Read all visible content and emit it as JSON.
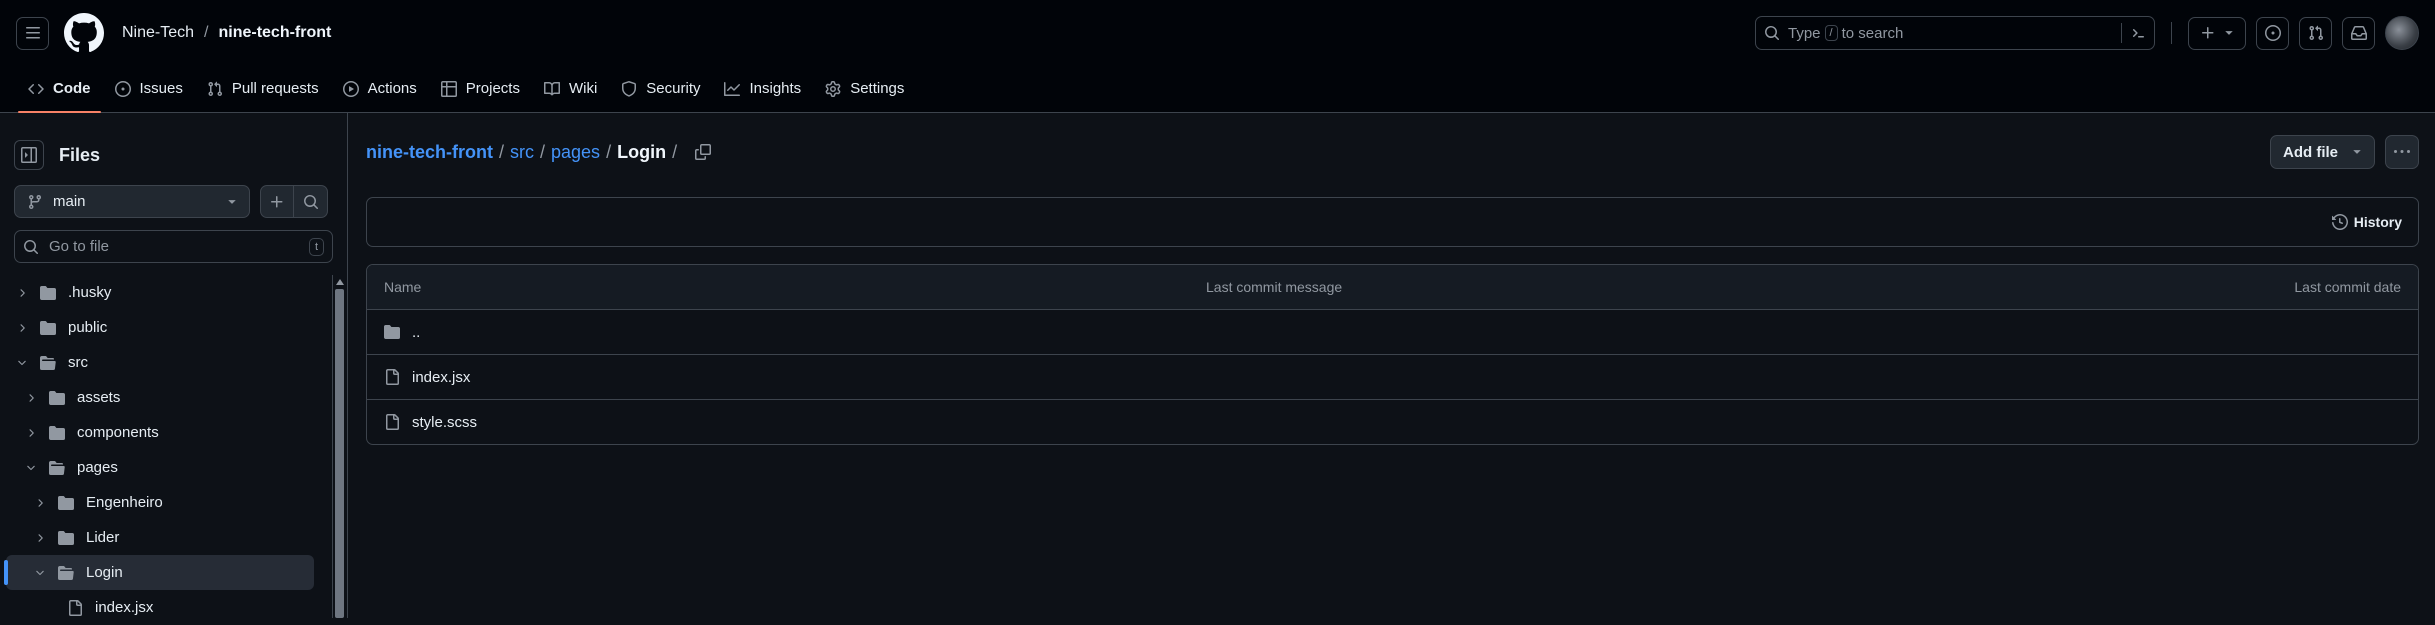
{
  "header": {
    "owner": "Nine-Tech",
    "separator": "/",
    "repo": "nine-tech-front",
    "search": {
      "prefix": "Type",
      "key": "/",
      "suffix": "to search"
    }
  },
  "tabs": [
    {
      "label": "Code",
      "icon": "code-icon",
      "active": true
    },
    {
      "label": "Issues",
      "icon": "issue-icon"
    },
    {
      "label": "Pull requests",
      "icon": "pull-request-icon"
    },
    {
      "label": "Actions",
      "icon": "play-icon"
    },
    {
      "label": "Projects",
      "icon": "table-icon"
    },
    {
      "label": "Wiki",
      "icon": "book-icon"
    },
    {
      "label": "Security",
      "icon": "shield-icon"
    },
    {
      "label": "Insights",
      "icon": "graph-icon"
    },
    {
      "label": "Settings",
      "icon": "gear-icon"
    }
  ],
  "sidebar": {
    "title": "Files",
    "branch": "main",
    "goto_placeholder": "Go to file",
    "goto_key": "t",
    "tree": [
      {
        "name": ".husky",
        "depth": 0,
        "type": "folder",
        "expanded": false
      },
      {
        "name": "public",
        "depth": 0,
        "type": "folder",
        "expanded": false
      },
      {
        "name": "src",
        "depth": 0,
        "type": "folder",
        "expanded": true
      },
      {
        "name": "assets",
        "depth": 1,
        "type": "folder",
        "expanded": false
      },
      {
        "name": "components",
        "depth": 1,
        "type": "folder",
        "expanded": false
      },
      {
        "name": "pages",
        "depth": 1,
        "type": "folder",
        "expanded": true
      },
      {
        "name": "Engenheiro",
        "depth": 2,
        "type": "folder",
        "expanded": false
      },
      {
        "name": "Lider",
        "depth": 2,
        "type": "folder",
        "expanded": false
      },
      {
        "name": "Login",
        "depth": 2,
        "type": "folder",
        "expanded": true,
        "selected": true
      },
      {
        "name": "index.jsx",
        "depth": 3,
        "type": "file"
      }
    ]
  },
  "breadcrumb": {
    "root": "nine-tech-front",
    "parts": [
      "src",
      "pages"
    ],
    "current": "Login",
    "separator": "/"
  },
  "actions": {
    "add_file": "Add file"
  },
  "commit": {
    "history_label": "History"
  },
  "table": {
    "headers": [
      "Name",
      "Last commit message",
      "Last commit date"
    ],
    "rows": [
      {
        "name": "..",
        "type": "folder"
      },
      {
        "name": "index.jsx",
        "type": "file"
      },
      {
        "name": "style.scss",
        "type": "file"
      }
    ]
  },
  "colors": {
    "bg": "#0d1117",
    "header_bg": "#010409",
    "border": "#3d444d",
    "link": "#4493f8",
    "tab_underline": "#f78166"
  }
}
